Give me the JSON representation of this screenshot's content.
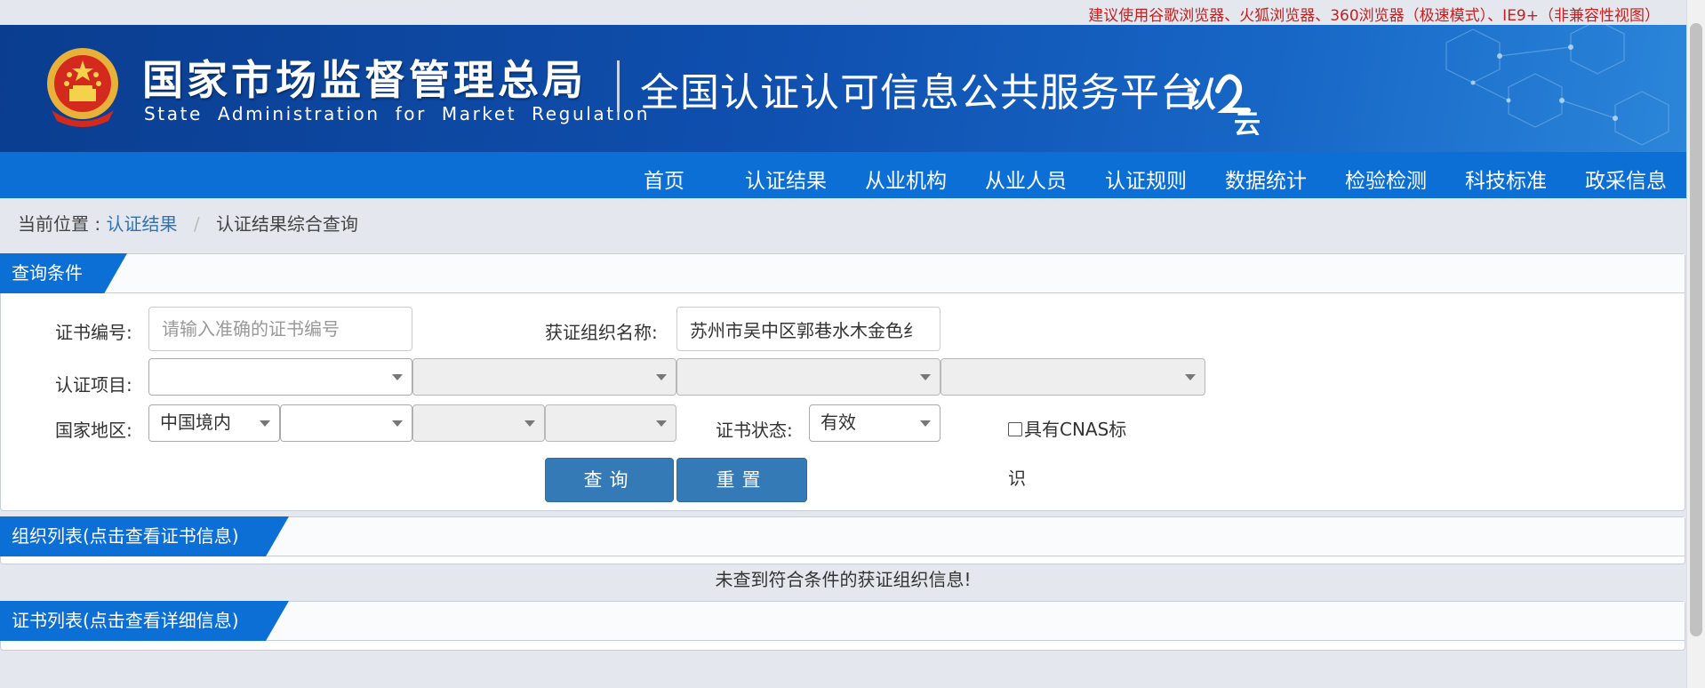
{
  "notice": "建议使用谷歌浏览器、火狐浏览器、360浏览器（极速模式）、IE9+（非兼容性视图）",
  "header": {
    "org_cn": "国家市场监督管理总局",
    "org_en": "State Administration for Market Regulation",
    "platform_title": "全国认证认可信息公共服务平台",
    "cloud_logo_text": "认云",
    "colors": {
      "header_dark": "#0a3d8f",
      "nav": "#0b6fd6",
      "notice_red": "#c81e1e"
    }
  },
  "nav": [
    "首页",
    "认证结果",
    "从业机构",
    "从业人员",
    "认证规则",
    "数据统计",
    "检验检测",
    "科技标准",
    "政采信息"
  ],
  "breadcrumb": {
    "prefix": "当前位置 :",
    "link": "认证结果",
    "current": "认证结果综合查询"
  },
  "query": {
    "title": "查询条件",
    "cert_no_label": "证书编号:",
    "cert_no_placeholder": "请输入准确的证书编号",
    "org_name_label": "获证组织名称:",
    "org_name_value": "苏州市吴中区郭巷水木金色纟",
    "project_label": "认证项目:",
    "region_label": "国家地区:",
    "region_value": "中国境内",
    "status_label": "证书状态:",
    "status_value": "有效",
    "cnas_label_line1": "具有CNAS标",
    "cnas_label_line2": "识",
    "search_button": "查询",
    "reset_button": "重置"
  },
  "org_list": {
    "title": "组织列表(点击查看证书信息)",
    "empty_message": "未查到符合条件的获证组织信息!"
  },
  "cert_list": {
    "title": "证书列表(点击查看详细信息)"
  }
}
